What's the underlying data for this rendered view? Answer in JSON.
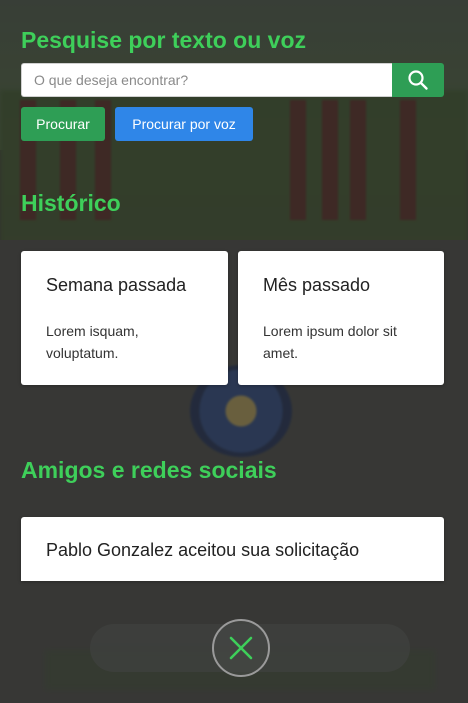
{
  "search": {
    "title": "Pesquise por texto ou voz",
    "placeholder": "O que deseja encontrar?",
    "search_button": "Procurar",
    "voice_button": "Procurar por voz"
  },
  "history": {
    "title": "Histórico",
    "cards": [
      {
        "title": "Semana passada",
        "text": "Lorem isquam, voluptatum."
      },
      {
        "title": "Mês passado",
        "text": "Lorem ipsum dolor sit amet."
      }
    ]
  },
  "social": {
    "title": "Amigos e redes sociais",
    "items": [
      {
        "text": "Pablo Gonzalez aceitou sua solicitação"
      }
    ]
  },
  "colors": {
    "accent_green": "#3ecf5a",
    "button_green": "#2e9e55",
    "button_blue": "#2f86e8"
  },
  "icons": {
    "search": "search-icon",
    "close": "close-icon"
  }
}
